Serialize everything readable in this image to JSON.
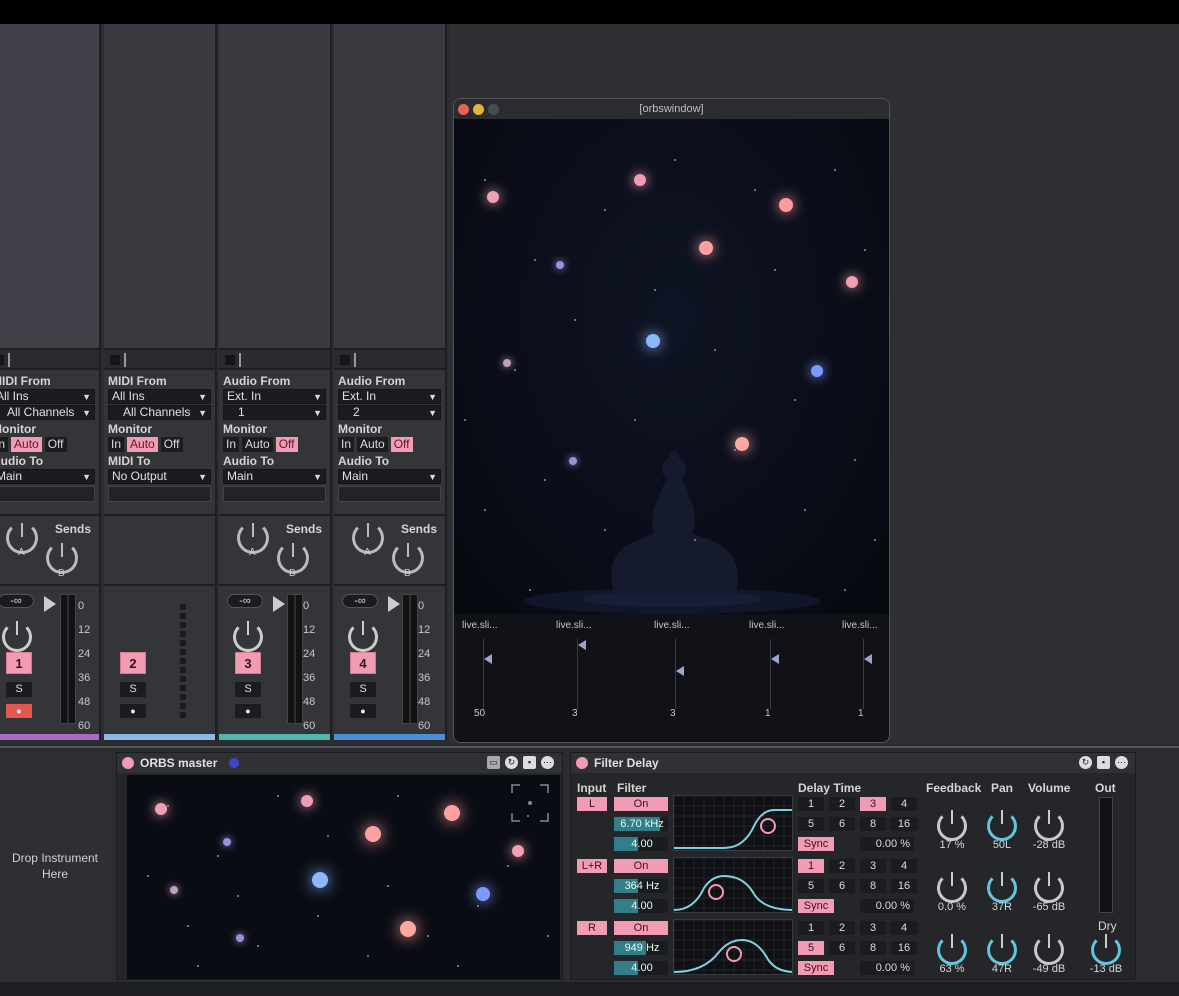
{
  "tracks": [
    {
      "io_label1": "MIDI From",
      "sel1": "All Ins",
      "sel2": "All Channels",
      "monitor_label": "Monitor",
      "mon": [
        "In",
        "Auto",
        "Off"
      ],
      "mon_on": 1,
      "io_label2": "Audio To",
      "sel3": "Main",
      "sends_title": "Sends",
      "send_a": "A",
      "send_b": "B",
      "vol_value": "-∞",
      "number": "1",
      "solo": "S",
      "arm": "●",
      "color": "#a86cc8"
    },
    {
      "io_label1": "MIDI From",
      "sel1": "All Ins",
      "sel2": "All Channels",
      "monitor_label": "Monitor",
      "mon": [
        "In",
        "Auto",
        "Off"
      ],
      "mon_on": 1,
      "io_label2": "MIDI To",
      "sel3": "No Output",
      "number": "2",
      "solo": "S",
      "arm": "●",
      "color": "#8fb8e6"
    },
    {
      "io_label1": "Audio From",
      "sel1": "Ext. In",
      "sel2": "1",
      "monitor_label": "Monitor",
      "mon": [
        "In",
        "Auto",
        "Off"
      ],
      "mon_on": 2,
      "io_label2": "Audio To",
      "sel3": "Main",
      "sends_title": "Sends",
      "send_a": "A",
      "send_b": "B",
      "vol_value": "-∞",
      "number": "3",
      "solo": "S",
      "arm": "●",
      "color": "#4fb8a8"
    },
    {
      "io_label1": "Audio From",
      "sel1": "Ext. In",
      "sel2": "2",
      "monitor_label": "Monitor",
      "mon": [
        "In",
        "Auto",
        "Off"
      ],
      "mon_on": 2,
      "io_label2": "Audio To",
      "sel3": "Main",
      "sends_title": "Sends",
      "send_a": "A",
      "send_b": "B",
      "vol_value": "-∞",
      "number": "4",
      "solo": "S",
      "arm": "●",
      "color": "#4a8fd8"
    }
  ],
  "db_scale": [
    "0",
    "12",
    "24",
    "36",
    "48",
    "60"
  ],
  "orbswindow": {
    "title": "[orbswindow]",
    "sliders": [
      {
        "label": "live.sli...",
        "value": "50"
      },
      {
        "label": "live.sli...",
        "value": "3"
      },
      {
        "label": "live.sli...",
        "value": "3"
      },
      {
        "label": "live.sli...",
        "value": "1"
      },
      {
        "label": "live.sli...",
        "value": "1"
      }
    ]
  },
  "drop_text": "Drop Instrument Here",
  "orbs_master": {
    "title": "ORBS master"
  },
  "filter_delay": {
    "title": "Filter Delay",
    "headers": {
      "input": "Input",
      "filter": "Filter",
      "delay_time": "Delay Time",
      "feedback": "Feedback",
      "pan": "Pan",
      "volume": "Volume",
      "out": "Out",
      "dry": "Dry"
    },
    "rows": [
      {
        "input": "L",
        "filter_on": "On",
        "freq": "6.70 kHz",
        "q": "4.00",
        "times": [
          "1",
          "2",
          "3",
          "4",
          "5",
          "6",
          "8",
          "16"
        ],
        "time_on": 2,
        "sync": "Sync",
        "offset": "0.00 %",
        "feedback": "17 %",
        "pan": "50L",
        "volume": "-28 dB"
      },
      {
        "input": "L+R",
        "filter_on": "On",
        "freq": "364 Hz",
        "q": "4.00",
        "times": [
          "1",
          "2",
          "3",
          "4",
          "5",
          "6",
          "8",
          "16"
        ],
        "time_on": 0,
        "sync": "Sync",
        "offset": "0.00 %",
        "feedback": "0.0 %",
        "pan": "37R",
        "volume": "-65 dB"
      },
      {
        "input": "R",
        "filter_on": "On",
        "freq": "949 Hz",
        "q": "4.00",
        "times": [
          "1",
          "2",
          "3",
          "4",
          "5",
          "6",
          "8",
          "16"
        ],
        "time_on": 4,
        "sync": "Sync",
        "offset": "0.00 %",
        "feedback": "63 %",
        "pan": "47R",
        "volume": "-49 dB"
      }
    ],
    "dry_value": "-13 dB"
  }
}
